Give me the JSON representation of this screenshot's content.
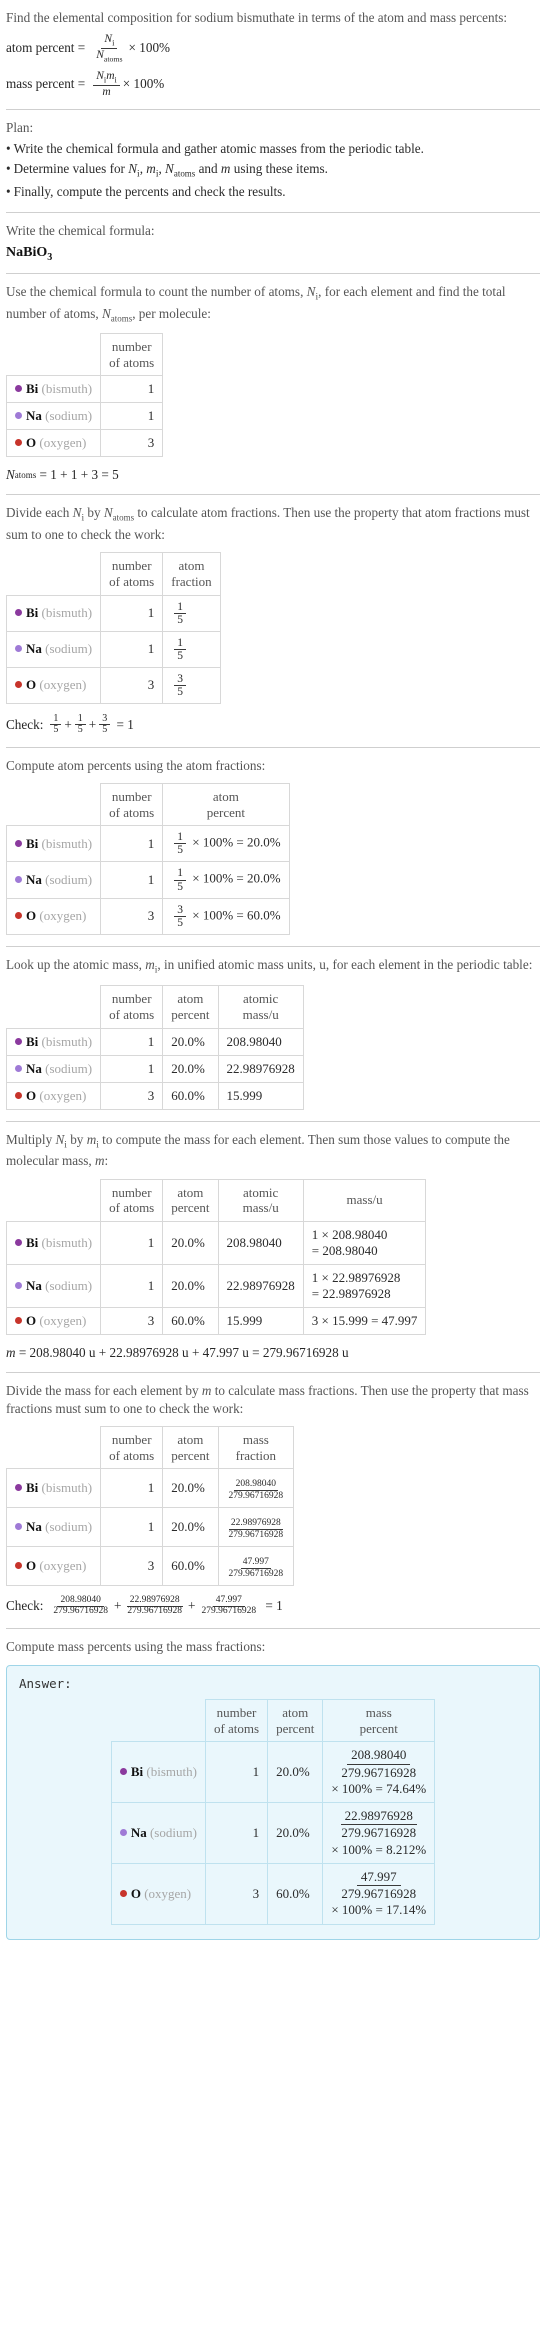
{
  "header": {
    "question": "Find the elemental composition for sodium bismuthate in terms of the atom and mass percents:",
    "atom_percent_label": "atom percent =",
    "atom_percent_num": "N",
    "atom_percent_num_sub": "i",
    "atom_percent_den": "N",
    "atom_percent_den_sub": "atoms",
    "times_100": "× 100%",
    "mass_percent_label": "mass percent =",
    "mass_percent_num": "N",
    "mass_percent_num_sub": "i",
    "mass_percent_num2": "m",
    "mass_percent_num2_sub": "i",
    "mass_percent_den": "m"
  },
  "plan": {
    "title": "Plan:",
    "bullet_char": "•",
    "items": [
      "Write the chemical formula and gather atomic masses from the periodic table.",
      "Determine values for Ni, mi, Natoms and m using these items.",
      "Finally, compute the percents and check the results."
    ],
    "item2_parts": {
      "pre": "Determine values for ",
      "v1": "N",
      "v1sub": "i",
      "sep1": ", ",
      "v2": "m",
      "v2sub": "i",
      "sep2": ", ",
      "v3": "N",
      "v3sub": "atoms",
      "mid": " and ",
      "v4": "m",
      "post": " using these items."
    }
  },
  "formula_section": {
    "prompt": "Write the chemical formula:",
    "formula_main": "NaBiO",
    "formula_sub": "3"
  },
  "count_section": {
    "prompt_pre": "Use the chemical formula to count the number of atoms, ",
    "prompt_v1": "N",
    "prompt_v1sub": "i",
    "prompt_mid": ", for each element and find the total number of atoms, ",
    "prompt_v2": "N",
    "prompt_v2sub": "atoms",
    "prompt_post": ", per molecule:",
    "header_number": "number",
    "header_of_atoms": "of atoms",
    "total_label": "N",
    "total_label_sub": "atoms",
    "total_expr": "= 1 + 1 + 3 = 5"
  },
  "elements": [
    {
      "symbol": "Bi",
      "name": "(bismuth)",
      "color": "#8b3a9e",
      "atoms": "1",
      "atom_fraction_num": "1",
      "atom_fraction_den": "5",
      "atom_percent": "20.0%",
      "atom_percent_expr": "× 100% = 20.0%",
      "atomic_mass": "208.98040",
      "mass_expr": "1 × 208.98040",
      "mass_expr2": "= 208.98040",
      "mass_frac_num": "208.98040",
      "mass_frac_den": "279.96716928",
      "mass_percent_expr": "× 100% = 74.64%"
    },
    {
      "symbol": "Na",
      "name": "(sodium)",
      "color": "#9f7ad6",
      "atoms": "1",
      "atom_fraction_num": "1",
      "atom_fraction_den": "5",
      "atom_percent": "20.0%",
      "atom_percent_expr": "× 100% = 20.0%",
      "atomic_mass": "22.98976928",
      "mass_expr": "1 × 22.98976928",
      "mass_expr2": "= 22.98976928",
      "mass_frac_num": "22.98976928",
      "mass_frac_den": "279.96716928",
      "mass_percent_expr": "× 100% = 8.212%"
    },
    {
      "symbol": "O",
      "name": "(oxygen)",
      "color": "#c7342b",
      "atoms": "3",
      "atom_fraction_num": "3",
      "atom_fraction_den": "5",
      "atom_percent": "60.0%",
      "atom_percent_expr": "× 100% = 60.0%",
      "atomic_mass": "15.999",
      "mass_expr": "3 × 15.999 = 47.997",
      "mass_expr2": "",
      "mass_frac_num": "47.997",
      "mass_frac_den": "279.96716928",
      "mass_percent_expr": "× 100% = 17.14%"
    }
  ],
  "atom_fraction_section": {
    "prompt_pre": "Divide each ",
    "v1": "N",
    "v1sub": "i",
    "prompt_mid": " by ",
    "v2": "N",
    "v2sub": "atoms",
    "prompt_post": " to calculate atom fractions. Then use the property that atom fractions must sum to one to check the work:",
    "header_number": "number",
    "header_of_atoms": "of atoms",
    "header_atom": "atom",
    "header_fraction": "fraction",
    "check_label": "Check:",
    "check_plus": "+",
    "check_result": "= 1"
  },
  "atom_percent_section": {
    "prompt": "Compute atom percents using the atom fractions:",
    "header_number": "number",
    "header_of_atoms": "of atoms",
    "header_atom": "atom",
    "header_percent": "percent"
  },
  "atomic_mass_section": {
    "prompt_pre": "Look up the atomic mass, ",
    "v1": "m",
    "v1sub": "i",
    "prompt_post": ", in unified atomic mass units, u, for each element in the periodic table:",
    "header_number": "number",
    "header_of_atoms": "of atoms",
    "header_atom": "atom",
    "header_percent": "percent",
    "header_atomic": "atomic",
    "header_mass_u": "mass/u"
  },
  "molecular_mass_section": {
    "prompt_pre": "Multiply ",
    "v1": "N",
    "v1sub": "i",
    "prompt_mid": " by ",
    "v2": "m",
    "v2sub": "i",
    "prompt_mid2": " to compute the mass for each element. Then sum those values to compute the molecular mass, ",
    "v3": "m",
    "prompt_post": ":",
    "header_number": "number",
    "header_of_atoms": "of atoms",
    "header_atom": "atom",
    "header_percent": "percent",
    "header_atomic": "atomic",
    "header_mass_u": "mass/u",
    "header_mass": "mass/u",
    "total_label": "m",
    "total_expr": "= 208.98040 u + 22.98976928 u + 47.997 u = 279.96716928 u"
  },
  "mass_fraction_section": {
    "prompt_pre": "Divide the mass for each element by ",
    "v1": "m",
    "prompt_post": " to calculate mass fractions. Then use the property that mass fractions must sum to one to check the work:",
    "header_number": "number",
    "header_of_atoms": "of atoms",
    "header_atom": "atom",
    "header_percent": "percent",
    "header_mass": "mass",
    "header_fraction": "fraction",
    "check_label": "Check:",
    "check_plus": "+",
    "check_result": "= 1"
  },
  "mass_percent_section": {
    "prompt": "Compute mass percents using the mass fractions:",
    "answer_label": "Answer:",
    "header_number": "number",
    "header_of_atoms": "of atoms",
    "header_atom": "atom",
    "header_percent": "percent",
    "header_mass": "mass",
    "header_mass_percent": "percent"
  }
}
